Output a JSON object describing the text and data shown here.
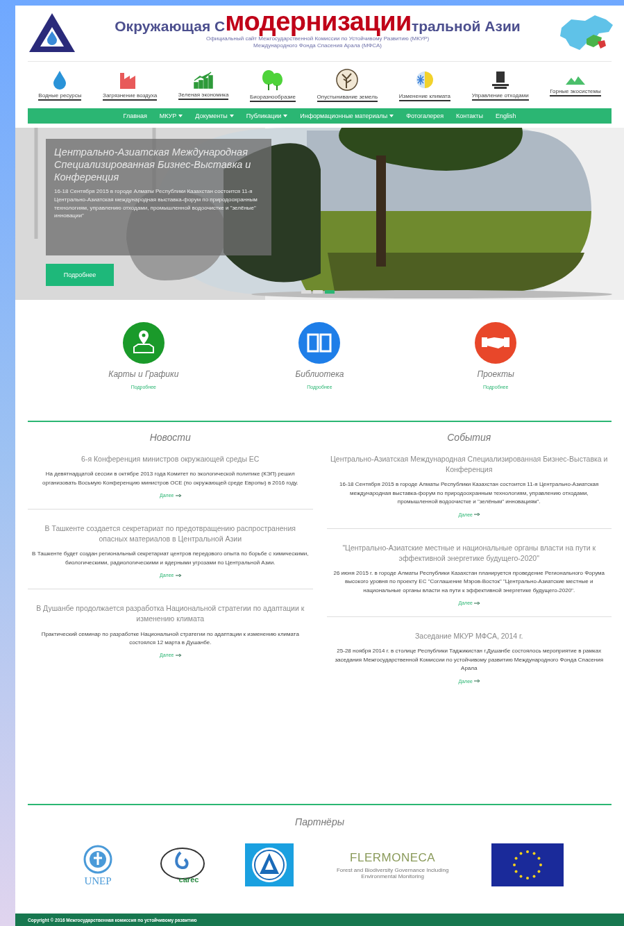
{
  "header": {
    "title_start": "Окружающая С",
    "overlay_word": "модернизации",
    "title_end": "тральной Азии",
    "subtitle_lines": [
      "Официальный сайт Межгосударственной Комиссии по Устойчивому Развитию (МКУР)",
      "Международного Фонда Спасения Арала (МФСА)"
    ]
  },
  "topics": [
    {
      "kind": "water",
      "label": "Водные ресурсы"
    },
    {
      "kind": "factory",
      "label": "Загрязнение воздуха"
    },
    {
      "kind": "chart",
      "label": "Зеленая экономика"
    },
    {
      "kind": "trees",
      "label": "Биоразнообразие"
    },
    {
      "kind": "tree-circle",
      "label": "Опустынивание земель"
    },
    {
      "kind": "climate",
      "label": "Изменение климата"
    },
    {
      "kind": "waste",
      "label": "Управление отходами"
    },
    {
      "kind": "mountains",
      "label": "Горные экосистемы"
    }
  ],
  "nav": [
    {
      "label": "Главная",
      "dropdown": false
    },
    {
      "label": "МКУР",
      "dropdown": true
    },
    {
      "label": "Документы",
      "dropdown": true
    },
    {
      "label": "Публикации",
      "dropdown": true
    },
    {
      "label": "Информационные материалы",
      "dropdown": true
    },
    {
      "label": "Фотогалерея",
      "dropdown": false
    },
    {
      "label": "Контакты",
      "dropdown": false
    },
    {
      "label": "English",
      "dropdown": false
    }
  ],
  "hero": {
    "kind": "picture",
    "title": "Центрально-Азиатская Международная Специализированная Бизнес-Выставка и Конференция",
    "text": "16-18 Сентября 2015 в городе Алматы Республики Казахстан состоится 11-я Центрально-Азиатская международная выставка-форум по природоохранным технологиям, управлению отходами, промышленной водоочистке и \"зелёные\" инновации\"",
    "button": "Подробнее",
    "dots": [
      {
        "selected": false
      },
      {
        "selected": false
      },
      {
        "selected": true
      }
    ]
  },
  "features": [
    {
      "kind": "map",
      "color": "#1a9a2a",
      "title": "Карты и Графики",
      "link": "Подробнее"
    },
    {
      "kind": "book",
      "color": "#1e7ee8",
      "title": "Библиотека",
      "link": "Подробнее"
    },
    {
      "kind": "handshake",
      "color": "#e8472a",
      "title": "Проекты",
      "link": "Подробнее"
    }
  ],
  "columns": [
    {
      "heading": "Новости",
      "items": [
        {
          "title": "6-я Конференция министров окружающей среды ЕС",
          "text": "На девятнадцатой сессии в октябре 2013 года Комитет по экологической политике (КЭП) решил организовать Восьмую Конференцию министров ОСЕ (по окружающей среде Европы) в 2016 году.",
          "more": "Далее"
        },
        {
          "title": "В Ташкенте создается секретариат по предотвращению распространения опасных материалов в Центральной Азии",
          "text": "В Ташкенте будет создан региональный секретариат центров передового опыта по борьбе с химическими, биологическими, радиологическими и ядерными угрозами по Центральной Азии.",
          "more": "Далее"
        },
        {
          "title": "В Душанбе продолжается разработка Национальной стратегии по адаптации к изменению климата",
          "text": "Практический семинар по разработке Национальной стратегии по адаптации к изменению климата состоялся 12 марта в Душанбе.",
          "more": "Далее"
        }
      ]
    },
    {
      "heading": "События",
      "items": [
        {
          "title": "Центрально-Азиатская Международная Специализированная Бизнес-Выставка и Конференция",
          "text": "16-18 Сентября 2015 в городе Алматы Республики Казахстан состоится 11-я Центрально-Азиатская международная выставка-форум по природоохранным технологиям, управлению отходами, промышленной водоочистке и \"зелёным\" инновациям\".",
          "more": "Далее"
        },
        {
          "title": "\"Центрально-Азиатские местные и национальные органы власти на пути к эффективной энергетике будущего-2020\"",
          "text": "26 июня 2015 г. в городе Алматы Республики Казахстан планируется проведение Регионального Форума высокого уровня по проекту ЕС \"Соглашение Мэров-Восток\" \"Центрально-Азиатские местные и национальные органы власти на пути к эффективной энергетике будущего-2020\".",
          "more": "Далее"
        },
        {
          "title": "Заседание МКУР МФСА, 2014 г.",
          "text": "25-28 ноября 2014 г. в столице Республики Таджикистан г.Душанбе состоялось мероприятие в рамках заседания Межгосударственной Комиссии по устойчивому развитию Международного Фонда Спасения Арала",
          "more": "Далее"
        }
      ]
    }
  ],
  "partners": {
    "heading": "Партнёры",
    "logos": [
      {
        "kind": "unep",
        "text": "UNEP"
      },
      {
        "kind": "carec",
        "text": "carec"
      },
      {
        "kind": "ifas"
      },
      {
        "kind": "flermoneca",
        "text": "FLERMONECA",
        "subtext": "Forest and Biodiversity Governance Including Environmental Monitoring"
      },
      {
        "kind": "eu"
      }
    ]
  },
  "footer": {
    "text": "Copyright © 2016 Межгосударственная комиссия по устойчивому развитию"
  }
}
